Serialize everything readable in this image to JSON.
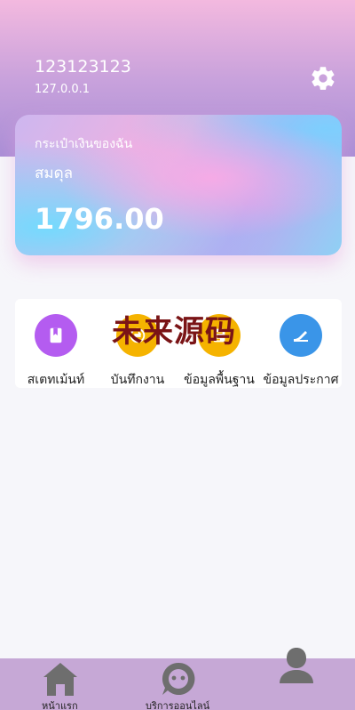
{
  "profile": {
    "username": "123123123",
    "ip": "127.0.0.1"
  },
  "wallet": {
    "title": "กระเป๋าเงินของฉัน",
    "balance_label": "สมดุล",
    "amount": "1796.00"
  },
  "menu": {
    "items": [
      {
        "label": "สเตทเม้นท์",
        "icon": "bookmark-icon",
        "color": "#b45cf0"
      },
      {
        "label": "บันทึกงาน",
        "icon": "exchange-icon",
        "color": "#f5b300"
      },
      {
        "label": "ข้อมูลพื้นฐาน",
        "icon": "info-icon",
        "color": "#f5b300"
      },
      {
        "label": "ข้อมูลประกาศ",
        "icon": "notice-icon",
        "color": "#3a95e8"
      }
    ]
  },
  "watermark": "未来源码",
  "tabbar": {
    "items": [
      {
        "label": "หน้าแรก",
        "icon": "home-icon"
      },
      {
        "label": "บริการออนไลน์",
        "icon": "chat-icon"
      },
      {
        "label": "",
        "icon": "user-icon"
      }
    ]
  }
}
